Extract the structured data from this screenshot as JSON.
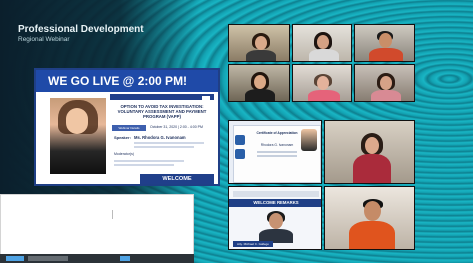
{
  "app": {
    "title": "Professional Development",
    "subtitle": "Regional Webinar"
  },
  "slide": {
    "headline": "WE GO LIVE @ 2:00 PM!",
    "topic": "OPTION TO AVOID TAX INVESTIGATION: VOLUNTARY ASSESSMENT AND PAYMENT PROGRAM (VAPP)",
    "session_label": "Webinar Details",
    "date_text": "October 31, 2020 | 2:00 - 4:00 PM",
    "speaker_label": "Speaker:",
    "speaker_name": "Ms. Rhodora G. Ivanonam",
    "moderator_label": "Moderator(s)",
    "welcome": "WELCOME"
  },
  "tiles": {
    "certificate_title": "Certificate of Appreciation",
    "certificate_name": "Rhodora G. Ivanonam",
    "welcome_remarks": "WELCOME REMARKS",
    "welcome_remarks_name": "Atty. Michael C. Gallego"
  },
  "colors": {
    "accent_blue": "#1f4aa8",
    "teal_background": "#19b5c4"
  },
  "icons": [
    "taskbar-app-icon"
  ]
}
